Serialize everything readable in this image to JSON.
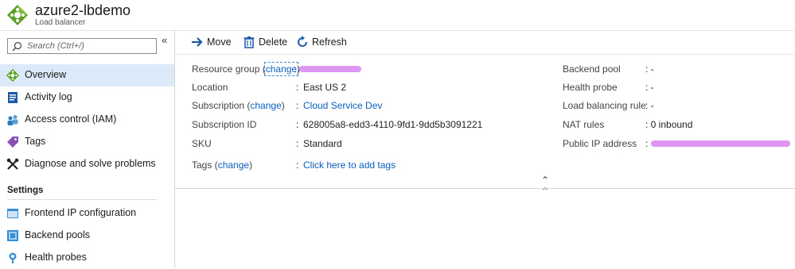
{
  "header": {
    "title": "azure2-lbdemo",
    "subtitle": "Load balancer"
  },
  "sidebar": {
    "search_placeholder": "Search (Ctrl+/)",
    "collapse_glyph": "«",
    "items": [
      {
        "label": "Overview",
        "icon": "overview-icon",
        "active": true
      },
      {
        "label": "Activity log",
        "icon": "activity-log-icon"
      },
      {
        "label": "Access control (IAM)",
        "icon": "iam-icon"
      },
      {
        "label": "Tags",
        "icon": "tag-icon"
      },
      {
        "label": "Diagnose and solve problems",
        "icon": "wrench-icon"
      }
    ],
    "settings_label": "Settings",
    "settings_items": [
      {
        "label": "Frontend IP configuration",
        "icon": "frontend-ip-icon"
      },
      {
        "label": "Backend pools",
        "icon": "backend-pool-icon"
      },
      {
        "label": "Health probes",
        "icon": "health-probe-icon"
      }
    ]
  },
  "toolbar": {
    "move": "Move",
    "delete": "Delete",
    "refresh": "Refresh"
  },
  "essentials": {
    "resource_group": {
      "label_prefix": "Resource group (",
      "change": "change",
      "label_suffix": ")"
    },
    "location": {
      "label": "Location",
      "value": "East US 2"
    },
    "subscription": {
      "label_prefix": "Subscription (",
      "change": "change",
      "label_suffix": ")",
      "value": "Cloud Service Dev"
    },
    "subscription_id": {
      "label": "Subscription ID",
      "value": "628005a8-edd3-4110-9fd1-9dd5b3091221"
    },
    "sku": {
      "label": "SKU",
      "value": "Standard"
    },
    "tags": {
      "label_prefix": "Tags (",
      "change": "change",
      "label_suffix": ")",
      "value": "Click here to add tags"
    },
    "backend_pool": {
      "label": "Backend pool",
      "value": "-"
    },
    "health_probe": {
      "label": "Health probe",
      "value": "-"
    },
    "load_balancing_rule": {
      "label": "Load balancing rule",
      "value": "-"
    },
    "nat_rules": {
      "label": "NAT rules",
      "value": "0 inbound"
    },
    "public_ip": {
      "label": "Public IP address"
    }
  },
  "colors": {
    "accent": "#0b5fbf",
    "active_bg": "#dbe9f8",
    "redaction": "#d98bf0"
  }
}
